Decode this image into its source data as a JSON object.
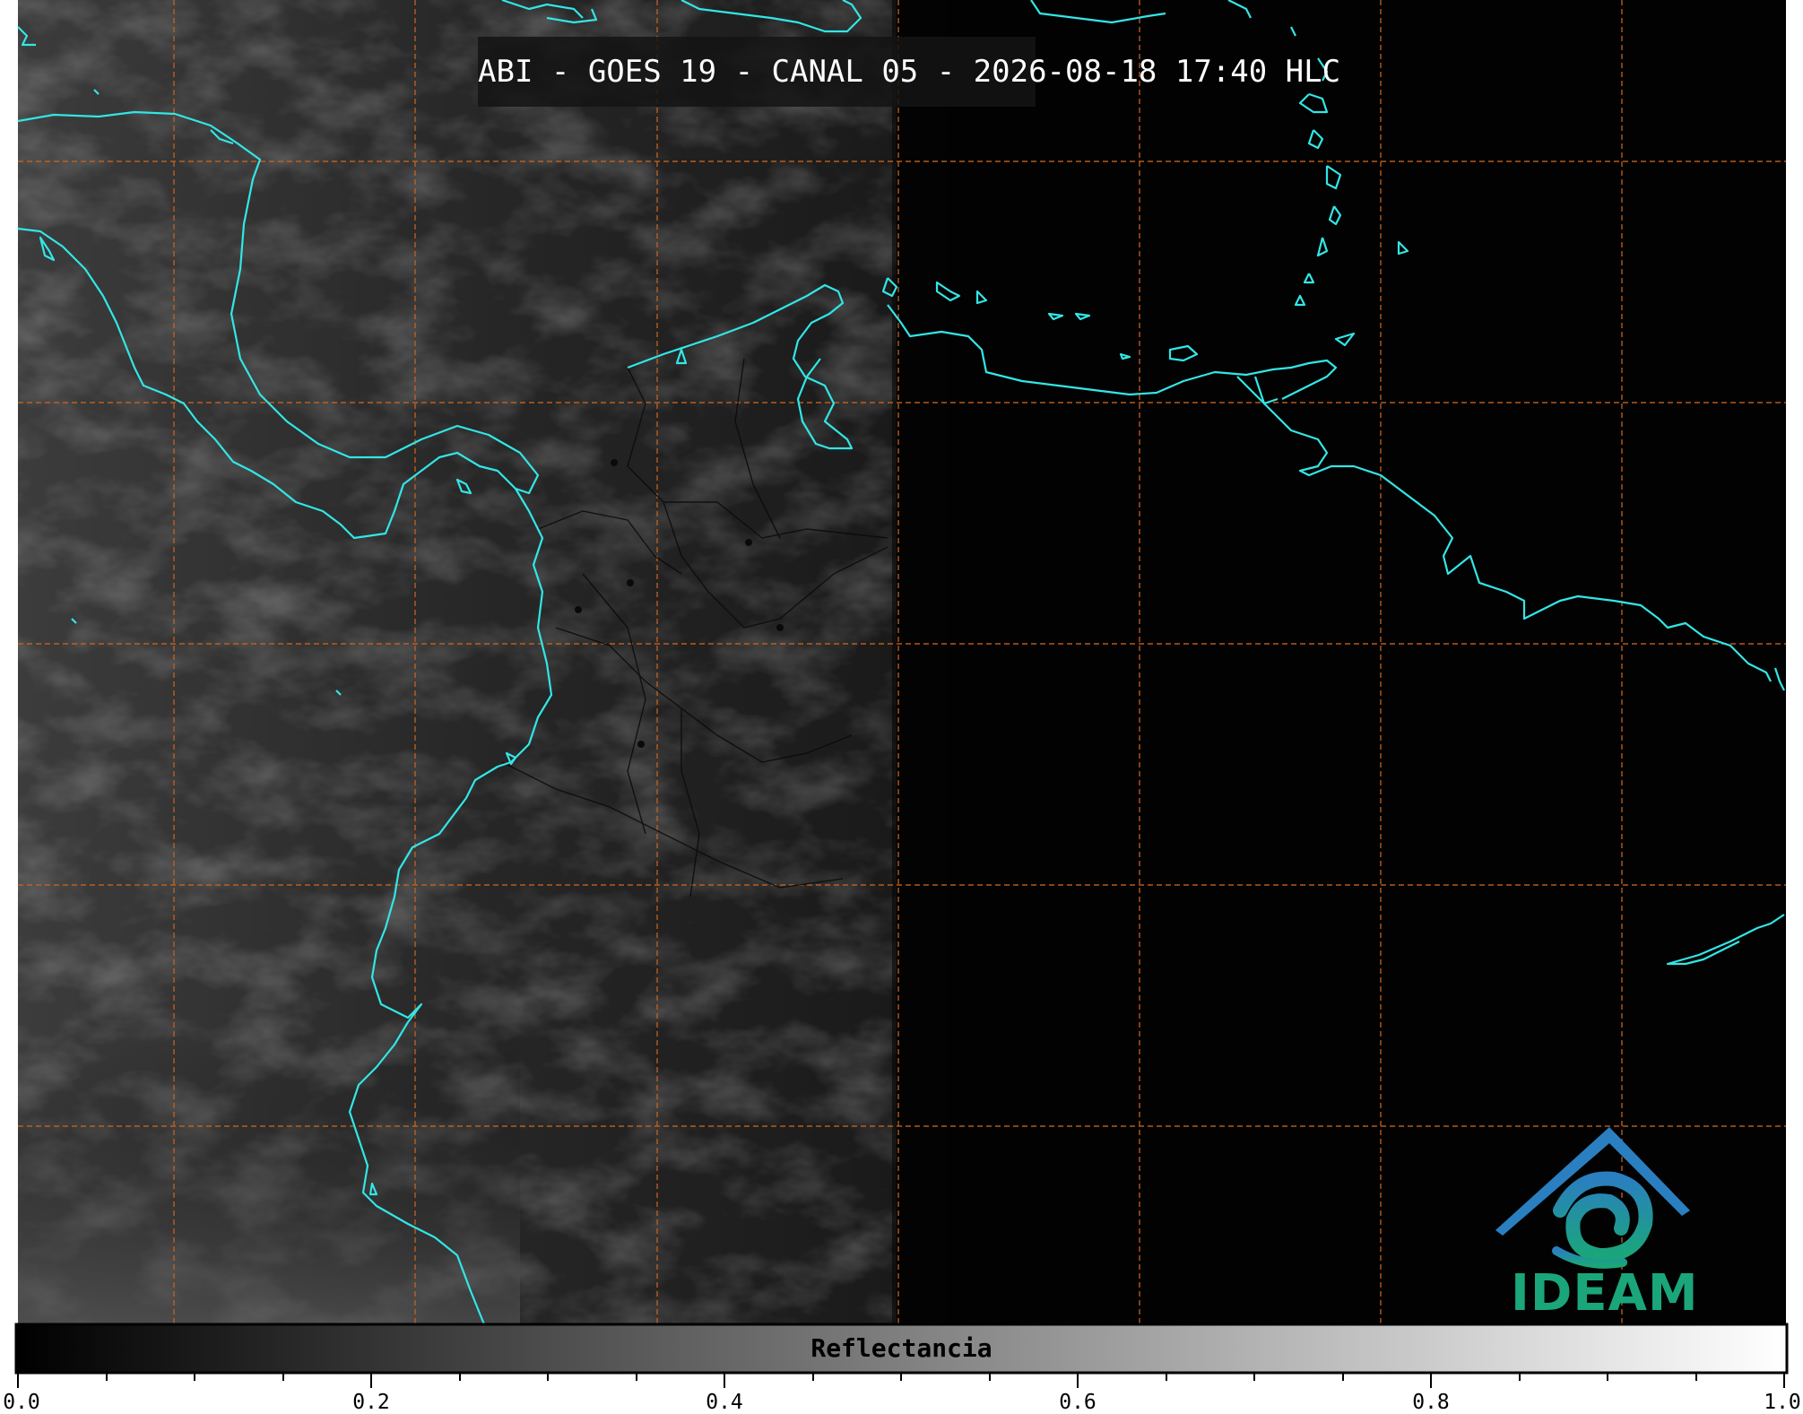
{
  "title": "ABI - GOES 19 - CANAL 05 - 2026-08-18 17:40 HLC",
  "logo_text": "IDEAM",
  "colorbar": {
    "label": "Reflectancia",
    "ticks": [
      "0.0",
      "0.2",
      "0.4",
      "0.6",
      "0.8",
      "1.0"
    ],
    "range": [
      0.0,
      1.0
    ]
  },
  "colors": {
    "coastline": "#33e6e6",
    "graticule": "#c8641e",
    "logo": "#1aa67a",
    "logo_top": "#2a7fc0"
  }
}
